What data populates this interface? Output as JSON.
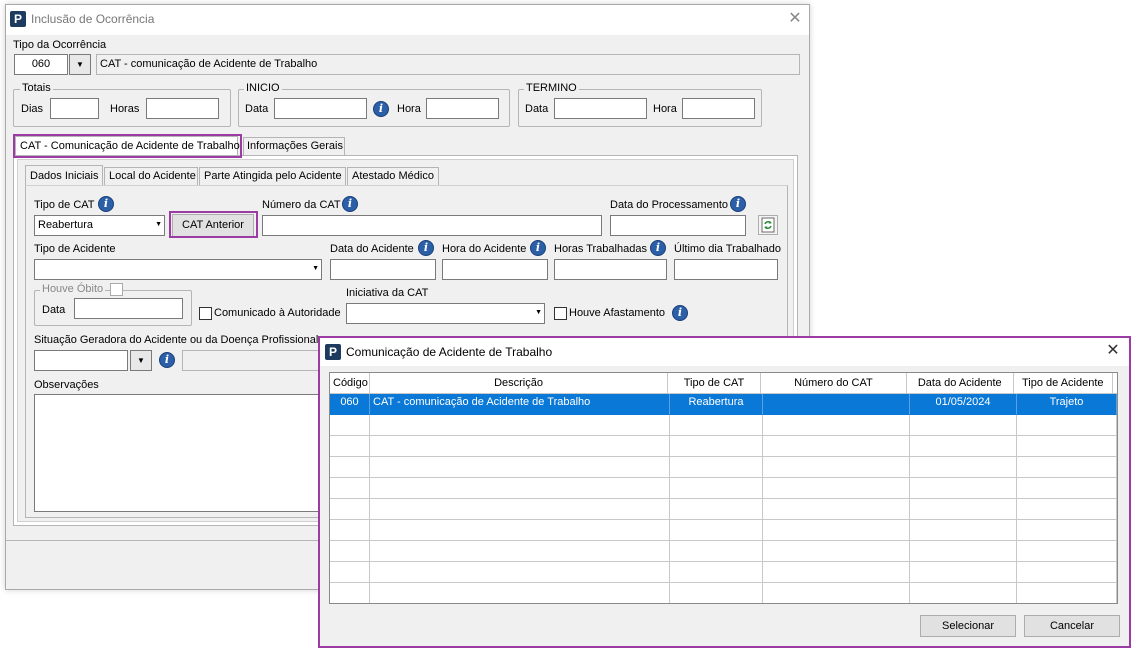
{
  "main_window": {
    "title": "Inclusão de Ocorrência",
    "tipo_label": "Tipo da Ocorrência",
    "tipo_code": "060",
    "tipo_desc": "CAT - comunicação de Acidente de Trabalho",
    "totais": {
      "title": "Totais",
      "dias": "Dias",
      "horas": "Horas"
    },
    "inicio": {
      "title": "INICIO",
      "data": "Data",
      "hora": "Hora"
    },
    "termino": {
      "title": "TERMINO",
      "data": "Data",
      "hora": "Hora"
    },
    "tabs": [
      {
        "label": "CAT - Comunicação de Acidente de Trabalho"
      },
      {
        "label": "Informações Gerais"
      }
    ],
    "subtabs": [
      {
        "label": "Dados Iniciais"
      },
      {
        "label": "Local do Acidente"
      },
      {
        "label": "Parte Atingida pelo Acidente"
      },
      {
        "label": "Atestado Médico"
      }
    ],
    "form": {
      "tipo_cat_label": "Tipo de CAT",
      "tipo_cat_value": "Reabertura",
      "cat_anterior": "CAT Anterior",
      "numero_cat_label": "Número da CAT",
      "data_proc_label": "Data do Processamento",
      "tipo_acidente_label": "Tipo de Acidente",
      "data_acidente_label": "Data do Acidente",
      "hora_acidente_label": "Hora do Acidente",
      "horas_trab_label": "Horas Trabalhadas",
      "ultimo_dia_label": "Último dia Trabalhado",
      "houve_obito_label": "Houve Óbito",
      "obito_data_label": "Data",
      "comunicado_label": "Comunicado à Autoridade",
      "iniciativa_label": "Iniciativa da CAT",
      "houve_afastamento_label": "Houve Afastamento",
      "situacao_label": "Situação Geradora do Acidente ou da Doença Profissional",
      "observacoes_label": "Observações"
    }
  },
  "dialog": {
    "title": "Comunicação de Acidente de Trabalho",
    "columns": [
      "Código",
      "Descrição",
      "Tipo de CAT",
      "Número do CAT",
      "Data do Acidente",
      "Tipo de Acidente"
    ],
    "rows": [
      [
        "060",
        "CAT - comunicação de Acidente de Trabalho",
        "Reabertura",
        "",
        "01/05/2024",
        "Trajeto"
      ]
    ],
    "select_button": "Selecionar",
    "cancel_button": "Cancelar"
  },
  "colors": {
    "highlight": "#9b3ca5",
    "selection": "#0a78d7",
    "info_icon": "#2b5fa8"
  }
}
